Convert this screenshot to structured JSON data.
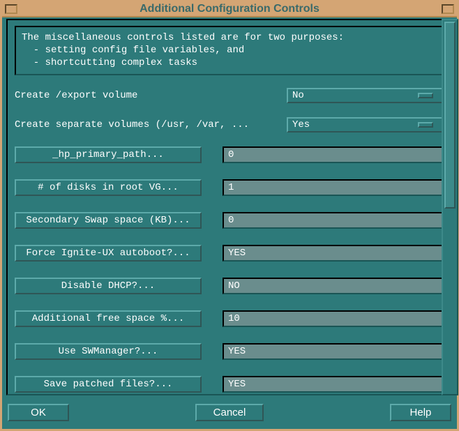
{
  "window": {
    "title": "Additional Configuration Controls"
  },
  "description": "The miscellaneous controls listed are for two purposes:\n  - setting config file variables, and\n  - shortcutting complex tasks",
  "options": {
    "create_export_label": "Create /export volume",
    "create_export_value": "No",
    "create_separate_label": "Create separate volumes (/usr, /var, ...",
    "create_separate_value": "Yes"
  },
  "params": [
    {
      "label": "_hp_primary_path...",
      "value": "0"
    },
    {
      "label": "# of disks in root VG...",
      "value": "1"
    },
    {
      "label": "Secondary Swap space (KB)...",
      "value": "0"
    },
    {
      "label": "Force Ignite-UX autoboot?...",
      "value": "YES"
    },
    {
      "label": "Disable DHCP?...",
      "value": "NO"
    },
    {
      "label": "Additional free space %...",
      "value": "10"
    },
    {
      "label": "Use SWManager?...",
      "value": "YES"
    },
    {
      "label": "Save patched files?...",
      "value": "YES"
    }
  ],
  "footer": {
    "ok": "OK",
    "cancel": "Cancel",
    "help": "Help"
  }
}
